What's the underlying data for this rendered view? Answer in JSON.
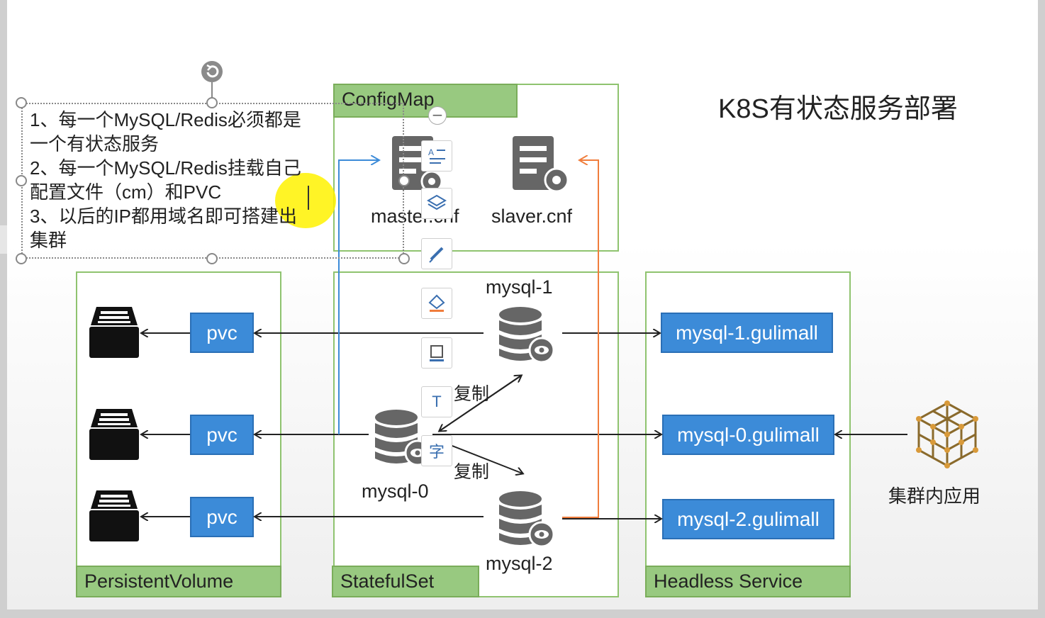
{
  "title": "K8S有状态服务部署",
  "note": {
    "lines": [
      "1、每一个MySQL/Redis必须都是",
      "一个有状态服务",
      "2、每一个MySQL/Redis挂载自己",
      "配置文件（cm）和PVC",
      "3、以后的IP都用域名即可搭建出",
      "集群"
    ]
  },
  "configmap": {
    "label": "ConfigMap",
    "files": [
      "master.cnf",
      "slaver.cnf"
    ]
  },
  "pv_panel": {
    "label": "PersistentVolume",
    "pvc_labels": [
      "pvc",
      "pvc",
      "pvc"
    ]
  },
  "statefulset": {
    "label": "StatefulSet",
    "pods": {
      "mysql1": "mysql-1",
      "mysql0": "mysql-0",
      "mysql2": "mysql-2"
    },
    "replicate_label_1": "复制",
    "replicate_label_2": "复制"
  },
  "headless": {
    "label": "Headless Service",
    "domains": [
      "mysql-1.gulimall",
      "mysql-0.gulimall",
      "mysql-2.gulimall"
    ]
  },
  "cluster_app": {
    "label": "集群内应用"
  },
  "toolbar": {
    "icons": [
      "text-style-icon",
      "layers-icon",
      "pen-icon",
      "fill-icon",
      "outline-icon",
      "text-box-icon",
      "translate-icon"
    ],
    "translate_glyph": "字",
    "text_glyph": "T"
  },
  "colors": {
    "panel_border": "#8fc36f",
    "tag_fill": "#98c980",
    "blue_box": "#3c8bd8",
    "arrow_blue": "#3c8bd8",
    "arrow_orange": "#f07d3c",
    "highlight": "#fff200"
  }
}
